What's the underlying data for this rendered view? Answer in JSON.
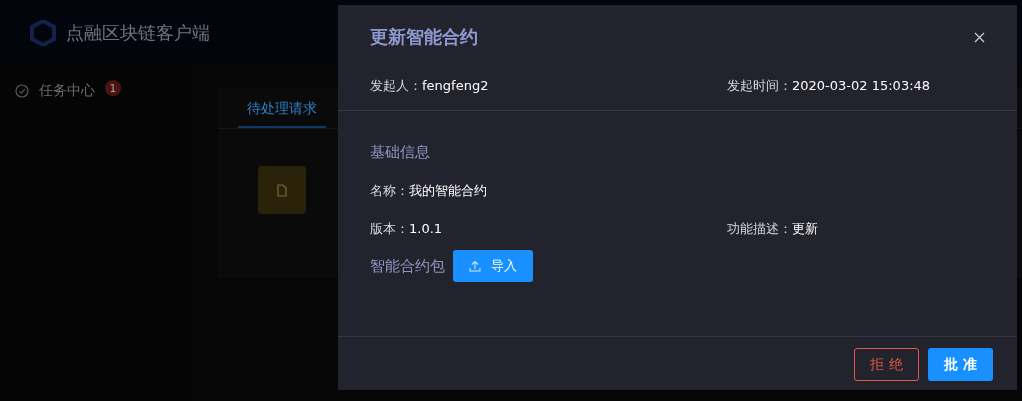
{
  "app": {
    "title": "点融区块链客户端"
  },
  "sidebar": {
    "items": [
      {
        "label": "任务中心",
        "badge": "1"
      }
    ]
  },
  "tabs": [
    {
      "label": "待处理请求",
      "selected": true
    }
  ],
  "dialog": {
    "title": "更新智能合约",
    "meta": [
      {
        "label": "发起人：",
        "value": "fengfeng2"
      },
      {
        "label": "发起时间：",
        "value": "2020-03-02 15:03:48"
      }
    ],
    "section": "基础信息",
    "info_rows": [
      [
        {
          "label": "名称：",
          "value": "我的智能合约"
        }
      ],
      [
        {
          "label": "版本：",
          "value": "1.0.1"
        },
        {
          "label": "功能描述：",
          "value": "更新"
        }
      ]
    ],
    "package": {
      "label": "智能合约包",
      "button": "导入"
    },
    "buttons": [
      {
        "label": "拒 绝",
        "kind": "reject"
      },
      {
        "label": "批 准",
        "kind": "approve"
      }
    ]
  }
}
